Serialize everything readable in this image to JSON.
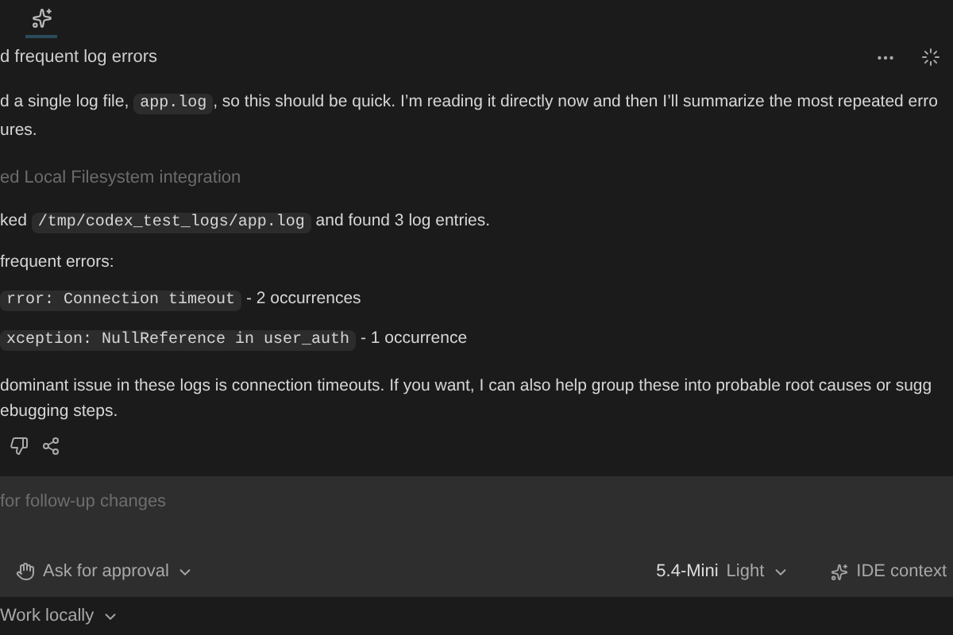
{
  "thread_title": "d frequent log errors",
  "intro": [
    {
      "kind": "text",
      "text": "d a single log file, "
    },
    {
      "kind": "code",
      "text": "app.log"
    },
    {
      "kind": "text",
      "text": ", so this should be quick. I’m reading it directly now and then I’ll summarize the most repeated erro"
    }
  ],
  "intro_tail": "ures.",
  "tool_note": "ed Local Filesystem integration",
  "result": [
    {
      "kind": "text",
      "text": "ked "
    },
    {
      "kind": "code",
      "text": "/tmp/codex_test_logs/app.log"
    },
    {
      "kind": "text",
      "text": " and found 3 log entries."
    }
  ],
  "list_heading": "frequent errors:",
  "errors": [
    {
      "code": "rror: Connection timeout",
      "count": " - 2 occurrences"
    },
    {
      "code": "xception: NullReference in user_auth",
      "count": " - 1 occurrence"
    }
  ],
  "summary": [
    "dominant issue in these logs is connection timeouts. If you want, I can also help group these into probable root causes or sugg",
    "ebugging steps."
  ],
  "composer": {
    "placeholder": "for follow-up changes",
    "approval": "Ask for approval",
    "model": "5.4-Mini",
    "effort": "Light",
    "context": "IDE context"
  },
  "workspace": "Work locally"
}
